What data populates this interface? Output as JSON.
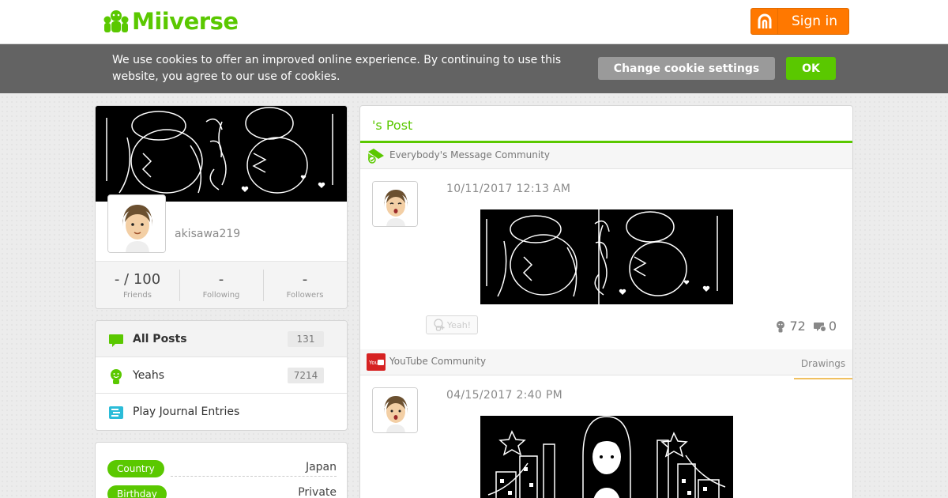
{
  "header": {
    "logo_text": "Miiverse",
    "signin_label": "Sign in"
  },
  "cookie": {
    "message": "We use cookies to offer an improved online experience. By continuing to use this website, you agree to our use of cookies.",
    "settings_label": "Change cookie settings",
    "ok_label": "OK"
  },
  "profile": {
    "username": "akisawa219",
    "stats": [
      {
        "value": "- / 100",
        "label": "Friends"
      },
      {
        "value": "-",
        "label": "Following"
      },
      {
        "value": "-",
        "label": "Followers"
      }
    ]
  },
  "menu": {
    "items": [
      {
        "label": "All Posts",
        "count": "131",
        "icon": "speech-bubble-icon"
      },
      {
        "label": "Yeahs",
        "count": "7214",
        "icon": "yeah-face-icon"
      },
      {
        "label": "Play Journal Entries",
        "count": "",
        "icon": "journal-icon"
      }
    ]
  },
  "info": {
    "rows": [
      {
        "key": "Country",
        "value": "Japan"
      },
      {
        "key": "Birthday",
        "value": "Private"
      }
    ]
  },
  "main": {
    "title": "'s Post",
    "posts": [
      {
        "community": "Everybody's Message Community",
        "community_icon": "message-community-icon",
        "date": "10/11/2017 12:13 AM",
        "yeah_label": "Yeah!",
        "yeah_count": "72",
        "comment_count": "0"
      },
      {
        "community": "YouTube Community",
        "community_icon": "youtube-icon",
        "tag": "Drawings",
        "date": "04/15/2017 2:40 PM"
      }
    ]
  },
  "colors": {
    "brand_green": "#5ac800",
    "signin_orange": "#ff7800",
    "cookie_bar": "#636363"
  }
}
